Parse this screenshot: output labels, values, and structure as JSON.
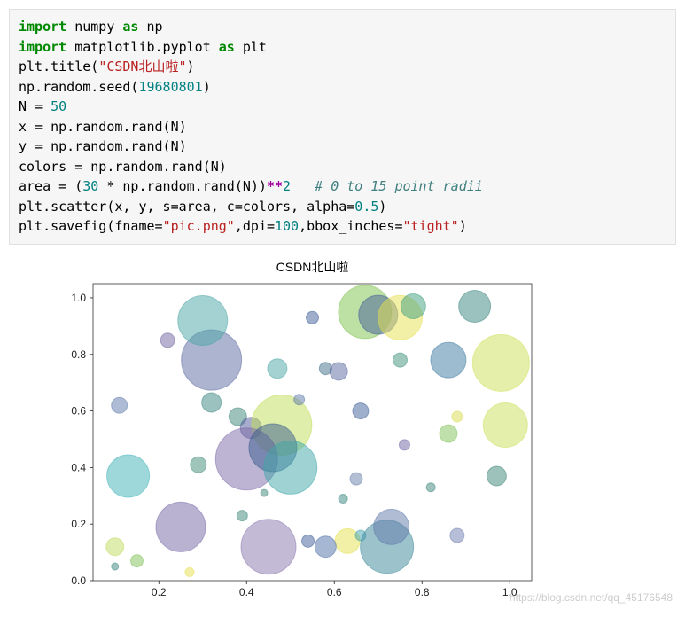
{
  "code": {
    "l1a": "import",
    "l1b": " numpy ",
    "l1c": "as",
    "l1d": " np",
    "l2a": "import",
    "l2b": " matplotlib.pyplot ",
    "l2c": "as",
    "l2d": " plt",
    "l3a": "plt.title(",
    "l3b": "\"CSDN北山啦\"",
    "l3c": ")",
    "l4a": "np.random.seed(",
    "l4b": "19680801",
    "l4c": ")",
    "l5a": "N ",
    "l5b": "=",
    "l5c": " ",
    "l5d": "50",
    "l6": "x = np.random.rand(N)",
    "l7": "y = np.random.rand(N)",
    "l8": "colors = np.random.rand(N)",
    "l9a": "area = (",
    "l9b": "30",
    "l9c": " * np.random.rand(N))",
    "l9d": "**",
    "l9e": "2",
    "l9f": "   ",
    "l9g": "# 0 to 15 point radii",
    "l10a": "plt.scatter(x, y, s=area, c=colors, alpha=",
    "l10b": "0.5",
    "l10c": ")",
    "l11a": "plt.savefig(fname=",
    "l11b": "\"pic.png\"",
    "l11c": ",dpi=",
    "l11d": "100",
    "l11e": ",bbox_inches=",
    "l11f": "\"tight\"",
    "l11g": ")"
  },
  "watermark": "https://blog.csdn.net/qq_45176548",
  "chart_data": {
    "type": "scatter",
    "title": "CSDN北山啦",
    "xlabel": "",
    "ylabel": "",
    "xlim": [
      0.05,
      1.05
    ],
    "ylim": [
      0.0,
      1.05
    ],
    "xticks": [
      0.2,
      0.4,
      0.6,
      0.8,
      1.0
    ],
    "yticks": [
      0.0,
      0.2,
      0.4,
      0.6,
      0.8,
      1.0
    ],
    "alpha": 0.5,
    "seed": 19680801,
    "N": 50,
    "points": [
      {
        "x": 0.92,
        "y": 0.97,
        "r": 18,
        "c": "#39857f"
      },
      {
        "x": 0.32,
        "y": 0.78,
        "r": 34,
        "c": "#5a6aa0"
      },
      {
        "x": 0.3,
        "y": 0.92,
        "r": 28,
        "c": "#49a5a5"
      },
      {
        "x": 0.22,
        "y": 0.85,
        "r": 8,
        "c": "#7166a2"
      },
      {
        "x": 0.67,
        "y": 0.95,
        "r": 30,
        "c": "#7bc24a"
      },
      {
        "x": 0.7,
        "y": 0.94,
        "r": 22,
        "c": "#445e98"
      },
      {
        "x": 0.75,
        "y": 0.93,
        "r": 25,
        "c": "#e6e04e"
      },
      {
        "x": 0.78,
        "y": 0.97,
        "r": 14,
        "c": "#40a080"
      },
      {
        "x": 0.98,
        "y": 0.77,
        "r": 32,
        "c": "#cde055"
      },
      {
        "x": 0.86,
        "y": 0.78,
        "r": 20,
        "c": "#3b7aa0"
      },
      {
        "x": 0.47,
        "y": 0.75,
        "r": 11,
        "c": "#49a5a5"
      },
      {
        "x": 0.32,
        "y": 0.63,
        "r": 11,
        "c": "#39857f"
      },
      {
        "x": 0.38,
        "y": 0.58,
        "r": 10,
        "c": "#3c8578"
      },
      {
        "x": 0.41,
        "y": 0.54,
        "r": 12,
        "c": "#52599c"
      },
      {
        "x": 0.48,
        "y": 0.55,
        "r": 34,
        "c": "#bfdd56"
      },
      {
        "x": 0.58,
        "y": 0.75,
        "r": 7,
        "c": "#406f8a"
      },
      {
        "x": 0.61,
        "y": 0.74,
        "r": 10,
        "c": "#5a6aa0"
      },
      {
        "x": 0.66,
        "y": 0.6,
        "r": 9,
        "c": "#3d5f99"
      },
      {
        "x": 0.88,
        "y": 0.58,
        "r": 6,
        "c": "#d9dc4e"
      },
      {
        "x": 0.99,
        "y": 0.55,
        "r": 25,
        "c": "#cbe059"
      },
      {
        "x": 0.13,
        "y": 0.37,
        "r": 24,
        "c": "#3eb2b7"
      },
      {
        "x": 0.29,
        "y": 0.41,
        "r": 9,
        "c": "#3f8b77"
      },
      {
        "x": 0.4,
        "y": 0.43,
        "r": 35,
        "c": "#7b6aa8"
      },
      {
        "x": 0.46,
        "y": 0.47,
        "r": 27,
        "c": "#375c8f"
      },
      {
        "x": 0.5,
        "y": 0.4,
        "r": 30,
        "c": "#3da5a8"
      },
      {
        "x": 0.86,
        "y": 0.52,
        "r": 10,
        "c": "#7fc258"
      },
      {
        "x": 0.97,
        "y": 0.37,
        "r": 11,
        "c": "#3c8578"
      },
      {
        "x": 0.76,
        "y": 0.48,
        "r": 6,
        "c": "#6f63a3"
      },
      {
        "x": 0.65,
        "y": 0.36,
        "r": 7,
        "c": "#667faa"
      },
      {
        "x": 0.1,
        "y": 0.12,
        "r": 10,
        "c": "#c0dc5f"
      },
      {
        "x": 0.15,
        "y": 0.07,
        "r": 7,
        "c": "#7fc258"
      },
      {
        "x": 0.25,
        "y": 0.19,
        "r": 28,
        "c": "#7366a3"
      },
      {
        "x": 0.39,
        "y": 0.23,
        "r": 6,
        "c": "#3c8578"
      },
      {
        "x": 0.45,
        "y": 0.12,
        "r": 31,
        "c": "#8876ae"
      },
      {
        "x": 0.54,
        "y": 0.14,
        "r": 7,
        "c": "#3d5e98"
      },
      {
        "x": 0.62,
        "y": 0.29,
        "r": 5,
        "c": "#39857f"
      },
      {
        "x": 0.63,
        "y": 0.14,
        "r": 14,
        "c": "#e5e04e"
      },
      {
        "x": 0.66,
        "y": 0.16,
        "r": 6,
        "c": "#3ea1b0"
      },
      {
        "x": 0.58,
        "y": 0.12,
        "r": 12,
        "c": "#4d6fa8"
      },
      {
        "x": 0.72,
        "y": 0.12,
        "r": 30,
        "c": "#39889a"
      },
      {
        "x": 0.73,
        "y": 0.19,
        "r": 20,
        "c": "#5f7aaa"
      },
      {
        "x": 0.88,
        "y": 0.16,
        "r": 8,
        "c": "#6f7daf"
      },
      {
        "x": 0.1,
        "y": 0.05,
        "r": 4,
        "c": "#39857f"
      },
      {
        "x": 0.11,
        "y": 0.62,
        "r": 9,
        "c": "#5e78a9"
      },
      {
        "x": 0.52,
        "y": 0.64,
        "r": 6,
        "c": "#5e78a9"
      },
      {
        "x": 0.44,
        "y": 0.31,
        "r": 4,
        "c": "#3c8578"
      },
      {
        "x": 0.82,
        "y": 0.33,
        "r": 5,
        "c": "#3c8578"
      },
      {
        "x": 0.27,
        "y": 0.03,
        "r": 5,
        "c": "#e7e04e"
      },
      {
        "x": 0.55,
        "y": 0.93,
        "r": 7,
        "c": "#3d5e98"
      },
      {
        "x": 0.75,
        "y": 0.78,
        "r": 8,
        "c": "#3f917a"
      }
    ]
  }
}
